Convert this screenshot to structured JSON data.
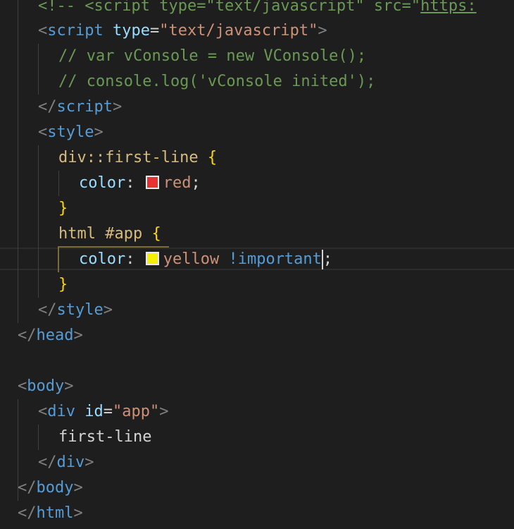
{
  "editor": {
    "lines": {
      "l0": {
        "open": "<!-- ",
        "tag_open": "<",
        "tag": "script",
        "attr1": " type",
        "eq1": "=",
        "val1": "\"text/javascript\"",
        "attr2": " src",
        "eq2": "=",
        "val2_quote": "\"",
        "val2_link": "https:"
      },
      "l1": {
        "lt": "<",
        "tag": "script",
        "attr": " type",
        "eq": "=",
        "val": "\"text/javascript\"",
        "gt": ">"
      },
      "l2": {
        "comment": "// var vConsole = new VConsole();"
      },
      "l3": {
        "comment": "// console.log('vConsole inited');"
      },
      "l4": {
        "lt": "</",
        "tag": "script",
        "gt": ">"
      },
      "l5": {
        "lt": "<",
        "tag": "style",
        "gt": ">"
      },
      "l6": {
        "selector": "div::first-line ",
        "brace": "{"
      },
      "l7": {
        "prop": "color",
        "colon": ": ",
        "value": "red",
        "semi": ";"
      },
      "l8": {
        "brace": "}"
      },
      "l9": {
        "selector": "html #app ",
        "brace": "{"
      },
      "l10": {
        "prop": "color",
        "colon": ": ",
        "value": "yellow",
        "important": " !important",
        "semi": ";"
      },
      "l11": {
        "brace": "}"
      },
      "l12": {
        "lt": "</",
        "tag": "style",
        "gt": ">"
      },
      "l13": {
        "lt": "</",
        "tag": "head",
        "gt": ">"
      },
      "l15": {
        "lt": "<",
        "tag": "body",
        "gt": ">"
      },
      "l16": {
        "lt": "<",
        "tag": "div",
        "attr": " id",
        "eq": "=",
        "val": "\"app\"",
        "gt": ">"
      },
      "l17": {
        "text": "first-line"
      },
      "l18": {
        "lt": "</",
        "tag": "div",
        "gt": ">"
      },
      "l19": {
        "lt": "</",
        "tag": "body",
        "gt": ">"
      },
      "l20": {
        "lt": "</",
        "tag": "html",
        "gt": ">"
      }
    },
    "swatch_colors": {
      "red": "#e8322e",
      "yellow": "#f4f000"
    },
    "theme": {
      "background": "#1e1e1e",
      "tag_bracket": "#808080",
      "tag_name": "#569cd6",
      "attribute": "#9cdcfe",
      "string": "#ce9178",
      "comment": "#6a9955",
      "selector": "#d7ba7d",
      "brace": "#ffd700"
    }
  }
}
